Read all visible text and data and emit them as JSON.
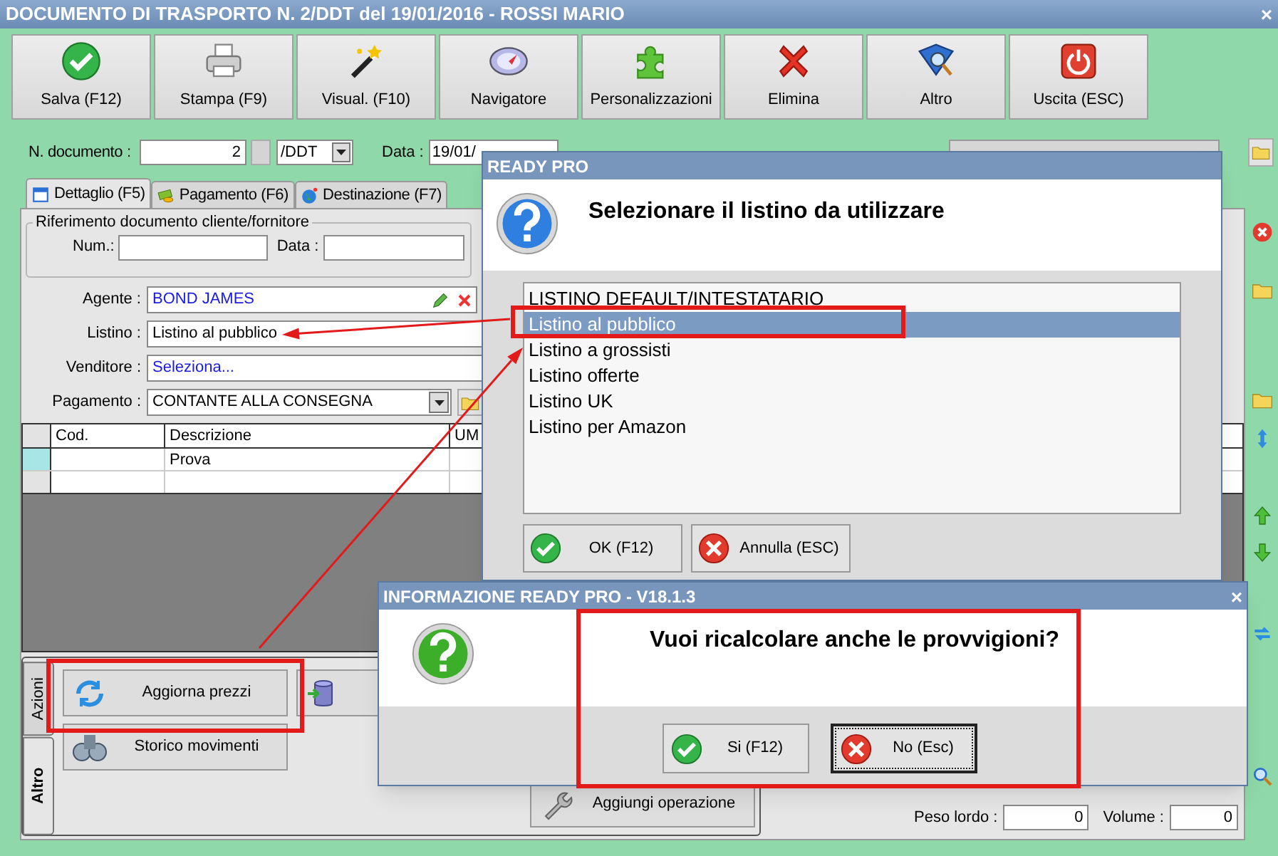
{
  "window": {
    "title": "DOCUMENTO DI TRASPORTO N. 2/DDT del 19/01/2016 - ROSSI MARIO",
    "close": "×"
  },
  "toolbar": [
    {
      "label": "Salva (F12)",
      "kind": "check"
    },
    {
      "label": "Stampa (F9)",
      "kind": "printer"
    },
    {
      "label": "Visual. (F10)",
      "kind": "wand"
    },
    {
      "label": "Navigatore",
      "kind": "compass"
    },
    {
      "label": "Personalizzazioni",
      "kind": "puzzle"
    },
    {
      "label": "Elimina",
      "kind": "cross"
    },
    {
      "label": "Altro",
      "kind": "book"
    },
    {
      "label": "Uscita (ESC)",
      "kind": "power"
    }
  ],
  "header": {
    "number_label": "N. documento :",
    "number": "2",
    "series": "/DDT",
    "date_label": "Data :",
    "date": "19/01/"
  },
  "tabs": [
    {
      "label": "Dettaglio (F5)",
      "selected": true,
      "kind": "calendar"
    },
    {
      "label": "Pagamento (F6)",
      "selected": false,
      "kind": "coins"
    },
    {
      "label": "Destinazione (F7)",
      "selected": false,
      "kind": "globe"
    }
  ],
  "reference": {
    "legend": "Riferimento documento cliente/fornitore",
    "num_label": "Num.:",
    "date_label": "Data :"
  },
  "fields": [
    {
      "label": "Agente :",
      "value": "BOND JAMES",
      "kind": "editable"
    },
    {
      "label": "Listino :",
      "value": "Listino al pubblico",
      "kind": "combo"
    },
    {
      "label": "Venditore :",
      "value": "Seleziona...",
      "kind": "link"
    },
    {
      "label": "Pagamento :",
      "value": "CONTANTE ALLA CONSEGNA",
      "kind": "lookup"
    }
  ],
  "grid": {
    "columns": [
      "Cod.",
      "Descrizione",
      "UM"
    ],
    "rows": [
      {
        "description": "Prova",
        "current": true
      }
    ]
  },
  "side_tabs": [
    {
      "label": "Azioni",
      "selected": false
    },
    {
      "label": "Altro",
      "selected": true
    }
  ],
  "action_columns": [
    [
      {
        "label": "Aggiorna prezzi",
        "kind": "refresh"
      },
      {
        "label": "Storico movimenti",
        "kind": "binoculars"
      }
    ],
    [
      {
        "kind": "database"
      }
    ],
    [
      {
        "label": "Aggiungi operazione",
        "kind": "wrench"
      }
    ]
  ],
  "totals": [
    {
      "label": "Peso lordo :",
      "value": "0"
    },
    {
      "label": "Volume :",
      "value": "0"
    }
  ],
  "list_dialog": {
    "title": "READY PRO",
    "message": "Selezionare il listino da utilizzare",
    "items": [
      {
        "label": "LISTINO DEFAULT/INTESTATARIO",
        "selected": false
      },
      {
        "label": "Listino al pubblico",
        "selected": true
      },
      {
        "label": "Listino a grossisti",
        "selected": false
      },
      {
        "label": "Listino offerte",
        "selected": false
      },
      {
        "label": "Listino UK",
        "selected": false
      },
      {
        "label": "Listino per Amazon",
        "selected": false
      }
    ],
    "buttons": [
      {
        "label": "OK (F12)",
        "kind": "ok"
      },
      {
        "label": "Annulla (ESC)",
        "kind": "cancel"
      }
    ]
  },
  "info_dialog": {
    "title": "INFORMAZIONE READY PRO - V18.1.3",
    "close": "×",
    "message": "Vuoi ricalcolare anche le provvigioni?",
    "buttons": [
      {
        "label": "Si (F12)",
        "kind": "ok",
        "focused": false
      },
      {
        "label": "No (Esc)",
        "kind": "cancel",
        "focused": true
      }
    ]
  }
}
